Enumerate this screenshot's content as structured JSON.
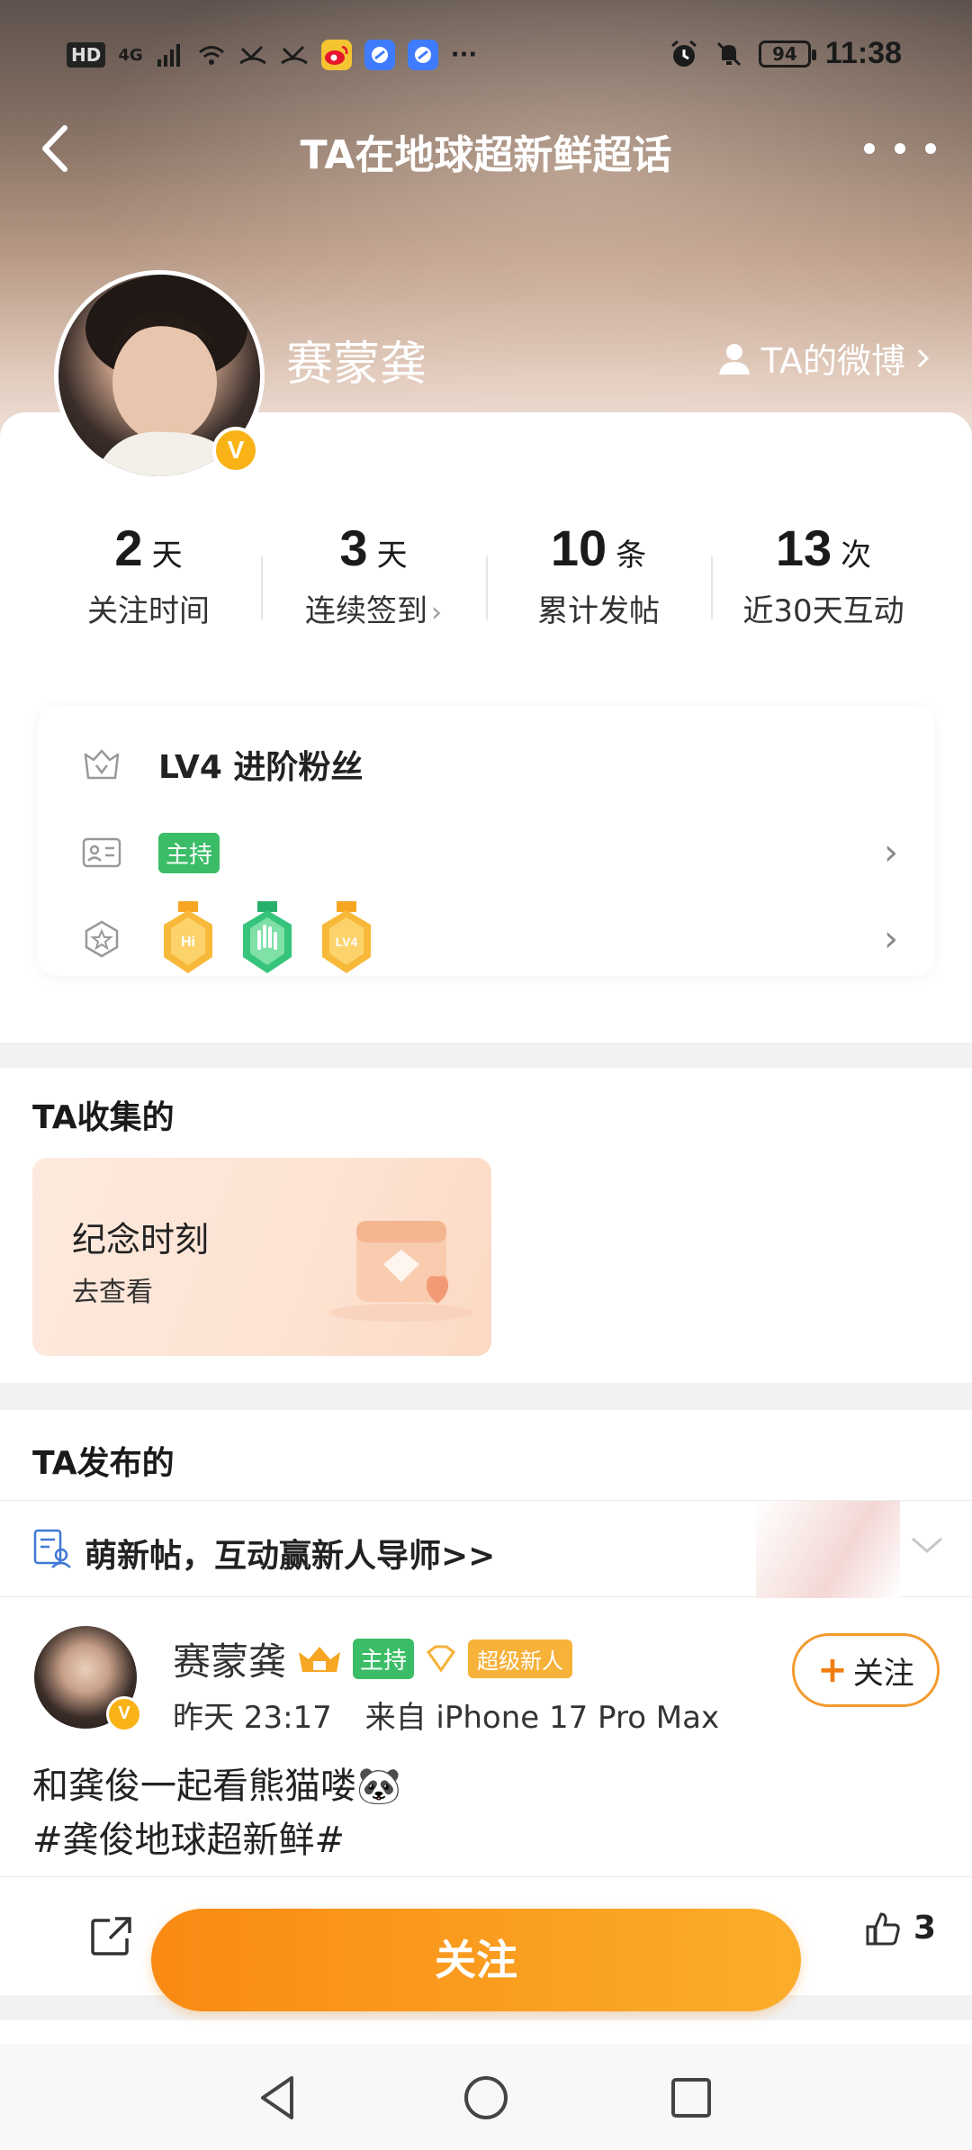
{
  "status_bar": {
    "network": "HD",
    "network_gen": "4G",
    "apps": [
      "weibo-icon",
      "app-icon",
      "app-icon"
    ],
    "more": "···",
    "battery": "94",
    "time": "11:38"
  },
  "header": {
    "title": "TA在地球超新鲜超话"
  },
  "profile": {
    "name": "赛蒙龚",
    "verified_badge": "V",
    "weibo_link": "TA的微博"
  },
  "stats": [
    {
      "value": "2",
      "unit": "天",
      "label": "关注时间"
    },
    {
      "value": "3",
      "unit": "天",
      "label": "连续签到"
    },
    {
      "value": "10",
      "unit": "条",
      "label": "累计发帖"
    },
    {
      "value": "13",
      "unit": "次",
      "label": "近30天互动"
    }
  ],
  "fan_card": {
    "level": "LV4 进阶粉丝",
    "role_tag": "主持",
    "medals": [
      "Hi",
      "",
      "LV4"
    ]
  },
  "collected": {
    "title": "TA收集的",
    "card_title": "纪念时刻",
    "card_sub": "去查看"
  },
  "published": {
    "title": "TA发布的",
    "newbie_text": "萌新帖，互动赢新人导师>>"
  },
  "post": {
    "author": "赛蒙龚",
    "tag_host": "主持",
    "tag_super": "超级新人",
    "time": "昨天 23:17",
    "source": "来自 iPhone 17 Pro Max",
    "follow_label": "关注",
    "line1": "和龚俊一起看熊猫喽🐼",
    "line2": "#龚俊地球超新鲜#",
    "likes": "3"
  },
  "follow_button": "关注",
  "colors": {
    "accent": "#f98a14",
    "host_tag": "#3bbd67",
    "verified": "#f9b316"
  }
}
